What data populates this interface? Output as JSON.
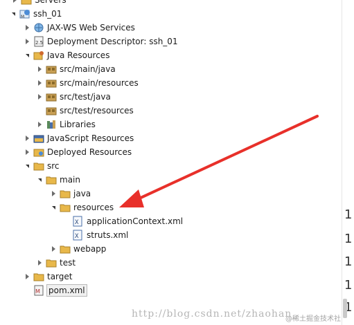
{
  "tree": {
    "items": [
      {
        "label": "Servers"
      },
      {
        "label": "ssh_01"
      },
      {
        "label": "JAX-WS Web Services"
      },
      {
        "label": "Deployment Descriptor: ssh_01"
      },
      {
        "label": "Java Resources"
      },
      {
        "label": "src/main/java"
      },
      {
        "label": "src/main/resources"
      },
      {
        "label": "src/test/java"
      },
      {
        "label": "src/test/resources"
      },
      {
        "label": "Libraries"
      },
      {
        "label": "JavaScript Resources"
      },
      {
        "label": "Deployed Resources"
      },
      {
        "label": "src"
      },
      {
        "label": "main"
      },
      {
        "label": "java"
      },
      {
        "label": "resources"
      },
      {
        "label": "applicationContext.xml"
      },
      {
        "label": "struts.xml"
      },
      {
        "label": "webapp"
      },
      {
        "label": "test"
      },
      {
        "label": "target"
      },
      {
        "label": "pom.xml"
      }
    ]
  },
  "editor_gutter": {
    "digits": [
      "1",
      "1",
      "1",
      "1",
      "1"
    ]
  },
  "watermark": {
    "text": "http://blog.csdn.net/zhaohan_"
  },
  "badge": {
    "text": "@稀土掘金技术社区"
  },
  "colors": {
    "arrow": "#e8302a",
    "folder": "#e8b84a",
    "package": "#c9a055"
  }
}
